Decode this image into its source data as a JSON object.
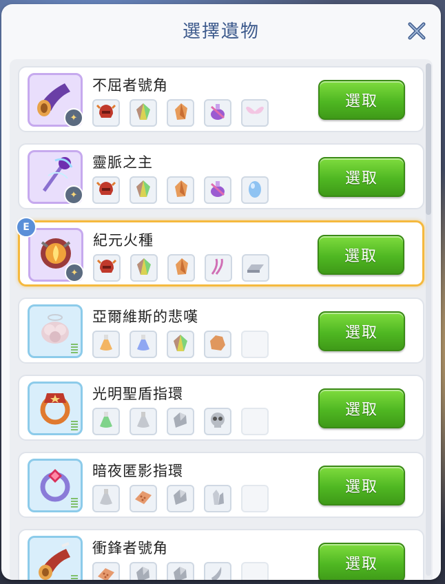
{
  "dialog": {
    "title": "選擇遺物",
    "close_icon": "close-icon"
  },
  "relics": [
    {
      "name": "不屈者號角",
      "frame": "purple",
      "badge": "star",
      "selected": false,
      "mats": [
        "helmet-red",
        "crystal-green",
        "shard-orange",
        "potion-purple",
        "wing-pink"
      ],
      "button": "選取"
    },
    {
      "name": "靈脈之主",
      "frame": "purple",
      "badge": "star",
      "selected": false,
      "mats": [
        "helmet-red",
        "crystal-green",
        "shard-orange",
        "potion-purple",
        "egg-blue"
      ],
      "button": "選取"
    },
    {
      "name": "紀元火種",
      "frame": "purple",
      "badge": "star",
      "selected": true,
      "e_badge": "E",
      "mats": [
        "helmet-red",
        "crystal-green",
        "shard-orange",
        "ribbon-pink",
        "ingot-gray"
      ],
      "button": "選取"
    },
    {
      "name": "亞爾維斯的悲嘆",
      "frame": "blue",
      "badge": "level",
      "selected": false,
      "mats": [
        "flask-orange",
        "flask-blue",
        "crystal-green",
        "stone-orange",
        "empty"
      ],
      "button": "選取"
    },
    {
      "name": "光明聖盾指環",
      "frame": "blue",
      "badge": "level",
      "selected": false,
      "mats": [
        "flask-green",
        "flask-gray",
        "stone-gray",
        "skull-gray",
        "empty"
      ],
      "button": "選取"
    },
    {
      "name": "暗夜匿影指環",
      "frame": "blue",
      "badge": "level",
      "selected": false,
      "mats": [
        "flask-gray",
        "brick-orange",
        "stone-gray",
        "crystal-gray",
        "empty"
      ],
      "button": "選取"
    },
    {
      "name": "衝鋒者號角",
      "frame": "blue",
      "badge": "level",
      "selected": false,
      "mats": [
        "brick-orange",
        "stone-gray",
        "stone-gray",
        "horn-gray",
        "empty"
      ],
      "button": "選取"
    }
  ],
  "colors": {
    "title": "#3d5a8c",
    "button_green": "#4fb722",
    "selected_border": "#f5b93e"
  }
}
